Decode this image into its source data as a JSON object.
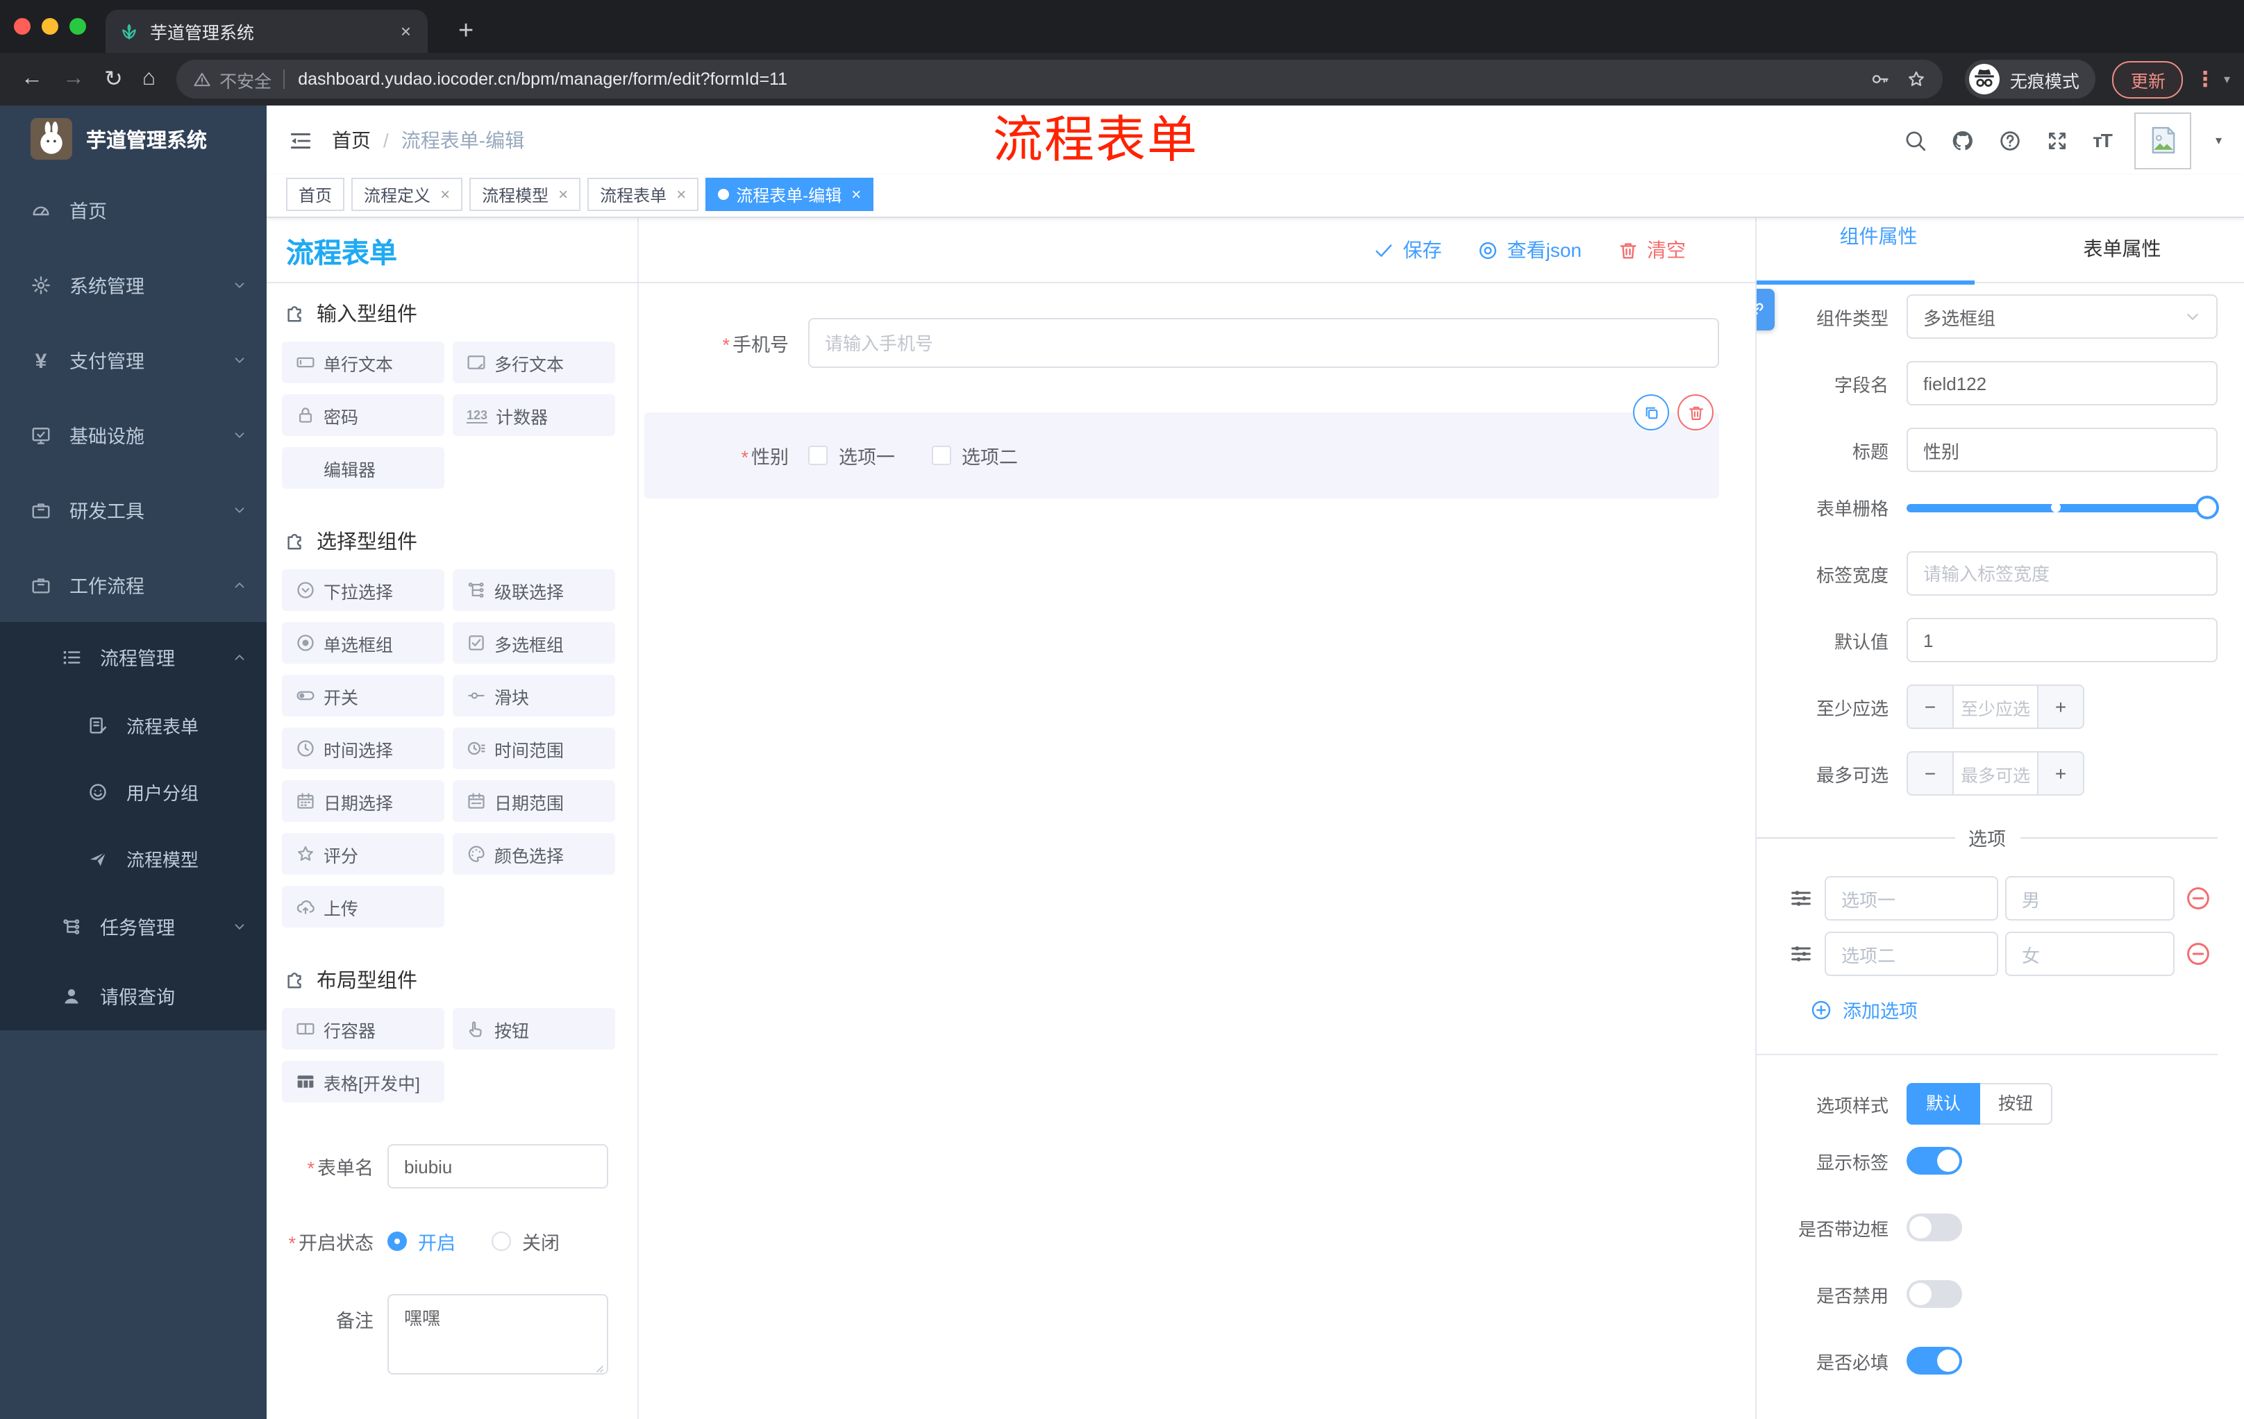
{
  "colors": {
    "accent": "#409EFF",
    "designer_title_blue": "#1FAAF3",
    "danger": "#F56C6C",
    "annotation_red": "#FF2200",
    "sidebar_bg": "#304156",
    "submenu_bg": "#1F2D3D",
    "active_tag": "#409EFF"
  },
  "misc": {
    "star": "*",
    "close": "×",
    "plus": "+",
    "dots": "⋮",
    "slash": "/",
    "caret": "▾",
    "minus": "−",
    "counter_icon": "123",
    "yen": "¥",
    "font_size_icon": "тT"
  },
  "browser": {
    "tab_title": "芋道管理系统",
    "security_label": "不安全",
    "url": "dashboard.yudao.iocoder.cn/bpm/manager/form/edit?formId=11",
    "incognito_label": "无痕模式",
    "update_label": "更新"
  },
  "sidebar": {
    "logo_title": "芋道管理系统",
    "items": [
      {
        "label": "首页"
      },
      {
        "label": "系统管理"
      },
      {
        "label": "支付管理"
      },
      {
        "label": "基础设施"
      },
      {
        "label": "研发工具"
      },
      {
        "label": "工作流程"
      },
      {
        "label": "流程管理"
      },
      {
        "label": "流程表单"
      },
      {
        "label": "用户分组"
      },
      {
        "label": "流程模型"
      },
      {
        "label": "任务管理"
      },
      {
        "label": "请假查询"
      }
    ]
  },
  "header": {
    "breadcrumb_home": "首页",
    "breadcrumb_current": "流程表单-编辑",
    "annotation": "流程表单"
  },
  "tags": {
    "items": [
      {
        "label": "首页"
      },
      {
        "label": "流程定义"
      },
      {
        "label": "流程模型"
      },
      {
        "label": "流程表单"
      },
      {
        "label": "流程表单-编辑"
      }
    ]
  },
  "designer": {
    "title": "流程表单",
    "toolbar": {
      "save": "保存",
      "view_json": "查看json",
      "clear": "清空"
    },
    "palette": {
      "groups": [
        {
          "title": "输入型组件",
          "items": [
            {
              "label": "单行文本"
            },
            {
              "label": "多行文本"
            },
            {
              "label": "密码"
            },
            {
              "label": "计数器"
            },
            {
              "label": "编辑器"
            }
          ]
        },
        {
          "title": "选择型组件",
          "items": [
            {
              "label": "下拉选择"
            },
            {
              "label": "级联选择"
            },
            {
              "label": "单选框组"
            },
            {
              "label": "多选框组"
            },
            {
              "label": "开关"
            },
            {
              "label": "滑块"
            },
            {
              "label": "时间选择"
            },
            {
              "label": "时间范围"
            },
            {
              "label": "日期选择"
            },
            {
              "label": "日期范围"
            },
            {
              "label": "评分"
            },
            {
              "label": "颜色选择"
            },
            {
              "label": "上传"
            }
          ]
        },
        {
          "title": "布局型组件",
          "items": [
            {
              "label": "行容器"
            },
            {
              "label": "按钮"
            },
            {
              "label": "表格[开发中]"
            }
          ]
        }
      ]
    },
    "meta": {
      "form_name_label": "表单名",
      "form_name_value": "biubiu",
      "status_label": "开启状态",
      "status_on": "开启",
      "status_off": "关闭",
      "remark_label": "备注",
      "remark_value": "嘿嘿"
    },
    "canvas": {
      "phone_label": "手机号",
      "phone_placeholder": "请输入手机号",
      "gender_label": "性别",
      "gender_option1": "选项一",
      "gender_option2": "选项二"
    },
    "props": {
      "tab_component": "组件属性",
      "tab_form": "表单属性",
      "component_type_label": "组件类型",
      "component_type_value": "多选框组",
      "field_name_label": "字段名",
      "field_name_value": "field122",
      "title_label": "标题",
      "title_value": "性别",
      "grid_label": "表单栅格",
      "label_width_label": "标签宽度",
      "label_width_placeholder": "请输入标签宽度",
      "default_label": "默认值",
      "default_value": "1",
      "min_label": "至少应选",
      "min_placeholder": "至少应选",
      "max_label": "最多可选",
      "max_placeholder": "最多可选",
      "options_title": "选项",
      "options": [
        {
          "label": "选项一",
          "value": "男"
        },
        {
          "label": "选项二",
          "value": "女"
        }
      ],
      "add_option": "添加选项",
      "style_label": "选项样式",
      "style_default": "默认",
      "style_button": "按钮",
      "show_label_label": "显示标签",
      "border_label": "是否带边框",
      "disabled_label": "是否禁用",
      "required_label": "是否必填"
    }
  }
}
